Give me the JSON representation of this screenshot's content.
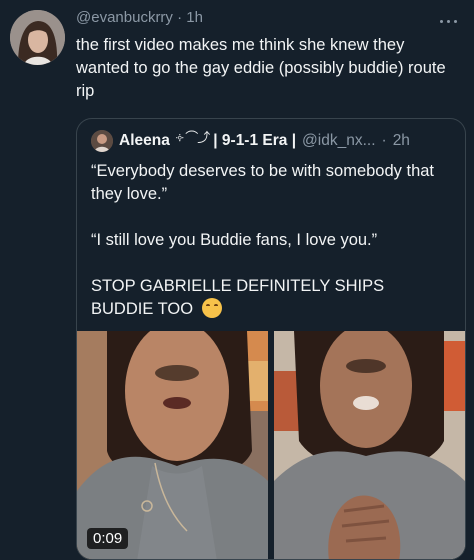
{
  "tweet": {
    "handle": "@evanbuckrry",
    "separator": "·",
    "time": "1h",
    "text": "the first video makes me think she knew they wanted to go the gay eddie (possibly buddie) route rip"
  },
  "quote": {
    "name": "Aleena",
    "name_decoration": "༓ ⌒⤴",
    "era": "| 9-1-1 Era |",
    "handle": "@idk_nx...",
    "separator": "·",
    "time": "2h",
    "paragraphs": [
      "“Everybody deserves to be with somebody that they love.”",
      "“I still love you Buddie fans, I love you.”",
      "STOP GABRIELLE DEFINITELY SHIPS BUDDIE TOO"
    ],
    "emoji": "shushing-face-emoji",
    "video_duration": "0:09"
  },
  "icons": {
    "more": "more-options-icon"
  },
  "colors": {
    "background": "#15202b",
    "secondary_text": "#8b98a5",
    "border": "#38444d"
  }
}
